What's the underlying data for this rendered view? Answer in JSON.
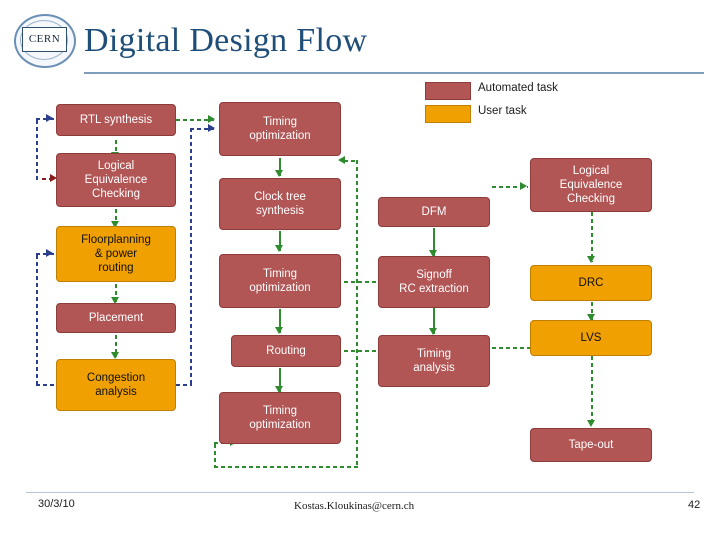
{
  "slide": {
    "title": "Digital Design Flow",
    "logo_text": "CERN",
    "footer": {
      "date": "30/3/10",
      "email": "Kostas.Kloukinas@cern.ch",
      "page_number": "42"
    }
  },
  "legend": {
    "items": [
      {
        "label": "Automated task",
        "color": "#b25555"
      },
      {
        "label": "User task",
        "color": "#f0a000"
      }
    ]
  },
  "diagram": {
    "type": "flow",
    "nodes": [
      {
        "id": "rtl",
        "label": "RTL synthesis",
        "kind": "automated"
      },
      {
        "id": "lec1",
        "label": "Logical\nEquivalence\nChecking",
        "kind": "automated"
      },
      {
        "id": "floorplan",
        "label": "Floorplanning\n& power\nrouting",
        "kind": "user"
      },
      {
        "id": "placement",
        "label": "Placement",
        "kind": "automated"
      },
      {
        "id": "congestion",
        "label": "Congestion\nanalysis",
        "kind": "user"
      },
      {
        "id": "timeopt1",
        "label": "Timing\noptimization",
        "kind": "automated"
      },
      {
        "id": "cts",
        "label": "Clock tree\nsynthesis",
        "kind": "automated"
      },
      {
        "id": "timeopt2",
        "label": "Timing\noptimization",
        "kind": "automated"
      },
      {
        "id": "routing",
        "label": "Routing",
        "kind": "automated"
      },
      {
        "id": "timeopt3",
        "label": "Timing\noptimization",
        "kind": "automated"
      },
      {
        "id": "dfm",
        "label": "DFM",
        "kind": "automated"
      },
      {
        "id": "signoff",
        "label": "Signoff\nRC extraction",
        "kind": "automated"
      },
      {
        "id": "timeanalysis",
        "label": "Timing\nanalysis",
        "kind": "automated"
      },
      {
        "id": "lec2",
        "label": "Logical\nEquivalence\nChecking",
        "kind": "automated"
      },
      {
        "id": "drc",
        "label": "DRC",
        "kind": "user"
      },
      {
        "id": "lvs",
        "label": "LVS",
        "kind": "user"
      },
      {
        "id": "tapeout",
        "label": "Tape-out",
        "kind": "automated"
      }
    ]
  }
}
